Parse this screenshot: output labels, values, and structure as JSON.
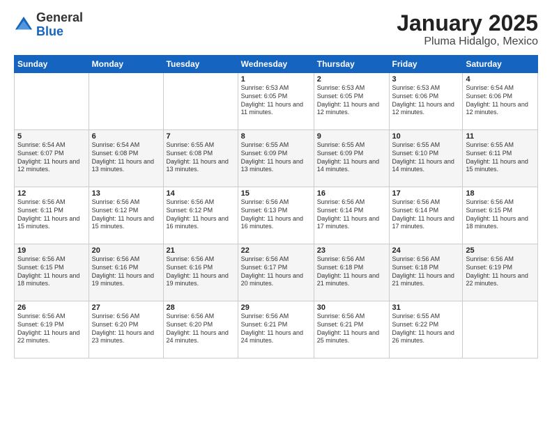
{
  "logo": {
    "general": "General",
    "blue": "Blue"
  },
  "header": {
    "title": "January 2025",
    "subtitle": "Pluma Hidalgo, Mexico"
  },
  "weekdays": [
    "Sunday",
    "Monday",
    "Tuesday",
    "Wednesday",
    "Thursday",
    "Friday",
    "Saturday"
  ],
  "weeks": [
    [
      {
        "day": "",
        "info": ""
      },
      {
        "day": "",
        "info": ""
      },
      {
        "day": "",
        "info": ""
      },
      {
        "day": "1",
        "info": "Sunrise: 6:53 AM\nSunset: 6:05 PM\nDaylight: 11 hours and 11 minutes."
      },
      {
        "day": "2",
        "info": "Sunrise: 6:53 AM\nSunset: 6:05 PM\nDaylight: 11 hours and 12 minutes."
      },
      {
        "day": "3",
        "info": "Sunrise: 6:53 AM\nSunset: 6:06 PM\nDaylight: 11 hours and 12 minutes."
      },
      {
        "day": "4",
        "info": "Sunrise: 6:54 AM\nSunset: 6:06 PM\nDaylight: 11 hours and 12 minutes."
      }
    ],
    [
      {
        "day": "5",
        "info": "Sunrise: 6:54 AM\nSunset: 6:07 PM\nDaylight: 11 hours and 12 minutes."
      },
      {
        "day": "6",
        "info": "Sunrise: 6:54 AM\nSunset: 6:08 PM\nDaylight: 11 hours and 13 minutes."
      },
      {
        "day": "7",
        "info": "Sunrise: 6:55 AM\nSunset: 6:08 PM\nDaylight: 11 hours and 13 minutes."
      },
      {
        "day": "8",
        "info": "Sunrise: 6:55 AM\nSunset: 6:09 PM\nDaylight: 11 hours and 13 minutes."
      },
      {
        "day": "9",
        "info": "Sunrise: 6:55 AM\nSunset: 6:09 PM\nDaylight: 11 hours and 14 minutes."
      },
      {
        "day": "10",
        "info": "Sunrise: 6:55 AM\nSunset: 6:10 PM\nDaylight: 11 hours and 14 minutes."
      },
      {
        "day": "11",
        "info": "Sunrise: 6:55 AM\nSunset: 6:11 PM\nDaylight: 11 hours and 15 minutes."
      }
    ],
    [
      {
        "day": "12",
        "info": "Sunrise: 6:56 AM\nSunset: 6:11 PM\nDaylight: 11 hours and 15 minutes."
      },
      {
        "day": "13",
        "info": "Sunrise: 6:56 AM\nSunset: 6:12 PM\nDaylight: 11 hours and 15 minutes."
      },
      {
        "day": "14",
        "info": "Sunrise: 6:56 AM\nSunset: 6:12 PM\nDaylight: 11 hours and 16 minutes."
      },
      {
        "day": "15",
        "info": "Sunrise: 6:56 AM\nSunset: 6:13 PM\nDaylight: 11 hours and 16 minutes."
      },
      {
        "day": "16",
        "info": "Sunrise: 6:56 AM\nSunset: 6:14 PM\nDaylight: 11 hours and 17 minutes."
      },
      {
        "day": "17",
        "info": "Sunrise: 6:56 AM\nSunset: 6:14 PM\nDaylight: 11 hours and 17 minutes."
      },
      {
        "day": "18",
        "info": "Sunrise: 6:56 AM\nSunset: 6:15 PM\nDaylight: 11 hours and 18 minutes."
      }
    ],
    [
      {
        "day": "19",
        "info": "Sunrise: 6:56 AM\nSunset: 6:15 PM\nDaylight: 11 hours and 18 minutes."
      },
      {
        "day": "20",
        "info": "Sunrise: 6:56 AM\nSunset: 6:16 PM\nDaylight: 11 hours and 19 minutes."
      },
      {
        "day": "21",
        "info": "Sunrise: 6:56 AM\nSunset: 6:16 PM\nDaylight: 11 hours and 19 minutes."
      },
      {
        "day": "22",
        "info": "Sunrise: 6:56 AM\nSunset: 6:17 PM\nDaylight: 11 hours and 20 minutes."
      },
      {
        "day": "23",
        "info": "Sunrise: 6:56 AM\nSunset: 6:18 PM\nDaylight: 11 hours and 21 minutes."
      },
      {
        "day": "24",
        "info": "Sunrise: 6:56 AM\nSunset: 6:18 PM\nDaylight: 11 hours and 21 minutes."
      },
      {
        "day": "25",
        "info": "Sunrise: 6:56 AM\nSunset: 6:19 PM\nDaylight: 11 hours and 22 minutes."
      }
    ],
    [
      {
        "day": "26",
        "info": "Sunrise: 6:56 AM\nSunset: 6:19 PM\nDaylight: 11 hours and 22 minutes."
      },
      {
        "day": "27",
        "info": "Sunrise: 6:56 AM\nSunset: 6:20 PM\nDaylight: 11 hours and 23 minutes."
      },
      {
        "day": "28",
        "info": "Sunrise: 6:56 AM\nSunset: 6:20 PM\nDaylight: 11 hours and 24 minutes."
      },
      {
        "day": "29",
        "info": "Sunrise: 6:56 AM\nSunset: 6:21 PM\nDaylight: 11 hours and 24 minutes."
      },
      {
        "day": "30",
        "info": "Sunrise: 6:56 AM\nSunset: 6:21 PM\nDaylight: 11 hours and 25 minutes."
      },
      {
        "day": "31",
        "info": "Sunrise: 6:55 AM\nSunset: 6:22 PM\nDaylight: 11 hours and 26 minutes."
      },
      {
        "day": "",
        "info": ""
      }
    ]
  ]
}
